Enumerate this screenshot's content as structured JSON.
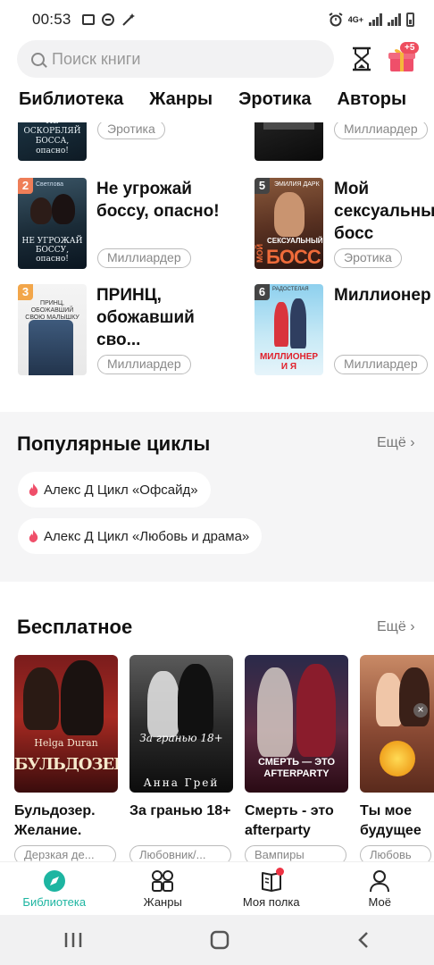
{
  "status_bar": {
    "time": "00:53",
    "network": "4G+"
  },
  "search": {
    "placeholder": "Поиск книги"
  },
  "gift": {
    "badge": "+5"
  },
  "tabs": [
    "Библиотека",
    "Жанры",
    "Эротика",
    "Авторы"
  ],
  "ranked_books": [
    {
      "rank": "",
      "title": "",
      "tag": "Эротика",
      "cover_text": "НЕ ОСКОРБЛЯЙ БОССА, опасно!"
    },
    {
      "rank": "",
      "title": "",
      "tag": "Миллиардер",
      "cover_text": ""
    },
    {
      "rank": "2",
      "title": "Не угрожай боссу, опасно!",
      "tag": "Миллиардер",
      "cover_text": "НЕ УГРОЖАЙ БОССУ, опасно!",
      "cover_author": "Светлова"
    },
    {
      "rank": "5",
      "title": "Мой сексуальный босс",
      "tag": "Эротика",
      "cover_text": "БОСС",
      "cover_sub": "СЕКСУАЛЬНЫЙ",
      "cover_side": "МОЙ",
      "cover_author": "ЭМИЛИЯ ДАРК"
    },
    {
      "rank": "3",
      "title": "ПРИНЦ, обожавший сво...",
      "tag": "Миллиардер",
      "cover_text": "ПРИНЦ, ОБОЖАВШИЙ СВОЮ МАЛЫШКУ"
    },
    {
      "rank": "6",
      "title": "Миллионер и",
      "tag": "Миллиардер",
      "cover_text": "МИЛЛИОНЕР И Я",
      "cover_author": "РАДОСТЕЛАЯ"
    }
  ],
  "popular_cycles": {
    "title": "Популярные циклы",
    "more": "Ещё",
    "items": [
      "Алекс Д Цикл «Офсайд»",
      "Алекс Д Цикл «Любовь и драма»"
    ]
  },
  "free": {
    "title": "Бесплатное",
    "more": "Ещё",
    "books": [
      {
        "title": "Бульдозер. Желание.",
        "tag": "Дерзкая де...",
        "cover_author": "Helga Duran",
        "cover_text": "БУЛЬДОЗЕР"
      },
      {
        "title": "За гранью 18+",
        "tag": "Любовник/...",
        "cover_text": "За гранью 18+",
        "cover_author": "Анна Грей"
      },
      {
        "title": "Смерть - это afterparty",
        "tag": "Вампиры",
        "cover_text": "СМЕРТЬ — ЭТО AFTERPARTY"
      },
      {
        "title": "Ты мое будущее",
        "tag": "Любовь",
        "cover_text": ""
      }
    ]
  },
  "bottom_nav": [
    {
      "label": "Библиотека",
      "icon": "compass-icon",
      "active": true
    },
    {
      "label": "Жанры",
      "icon": "grid-icon",
      "active": false
    },
    {
      "label": "Моя полка",
      "icon": "book-icon",
      "active": false
    },
    {
      "label": "Моё",
      "icon": "person-icon",
      "active": false
    }
  ],
  "colors": {
    "accent": "#1db5a1",
    "badge_red": "#ee4d5e",
    "flame": "#ef4f6a"
  }
}
